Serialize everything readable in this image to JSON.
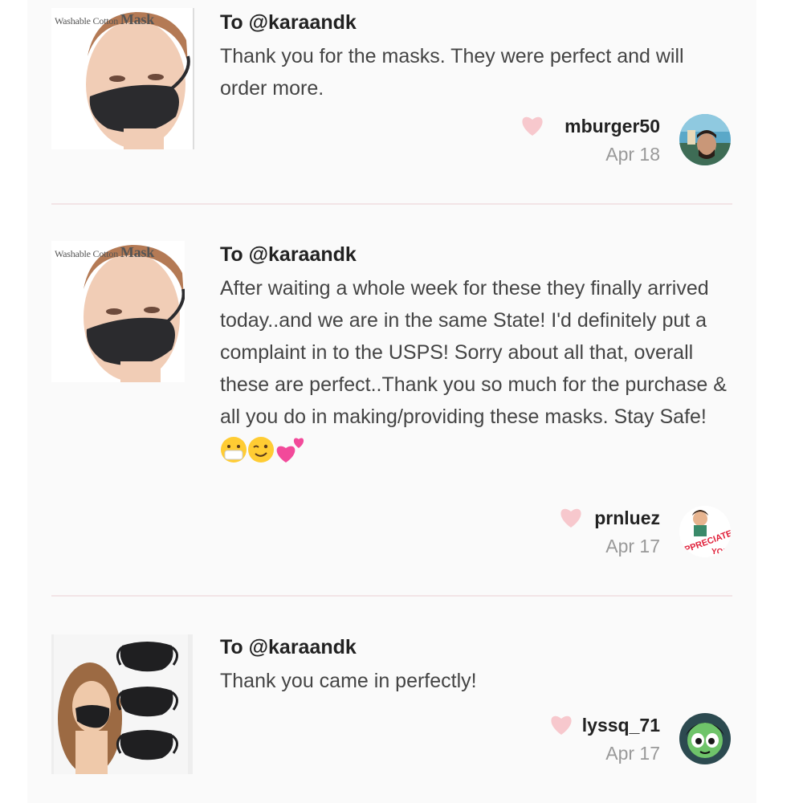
{
  "reviews": [
    {
      "thumb_caption_small": "Washable Cotton",
      "thumb_caption_big": "Mask",
      "to_label": "To ",
      "to_handle": "@karaandk",
      "text": "Thank you for the masks. They were perfect and will order more.",
      "username": "mburger50",
      "date": "Apr 18"
    },
    {
      "thumb_caption_small": "Washable Cotton",
      "thumb_caption_big": "Mask",
      "to_label": "To ",
      "to_handle": "@karaandk",
      "text": "After waiting a whole week for these they finally arrived today..and we are in the same State! I'd definitely put a complaint in to the USPS! Sorry about all that, overall these are perfect..Thank you so much for the purchase & all you do in making/providing these masks. Stay Safe!",
      "username": "prnluez",
      "date": "Apr 17"
    },
    {
      "to_label": "To ",
      "to_handle": "@karaandk",
      "text": "Thank you came in perfectly!",
      "username": "lyssq_71",
      "date": "Apr 17"
    }
  ],
  "colors": {
    "heart": "#f7c8cd",
    "divider": "#f2e4e6",
    "panel": "#fafafa"
  }
}
